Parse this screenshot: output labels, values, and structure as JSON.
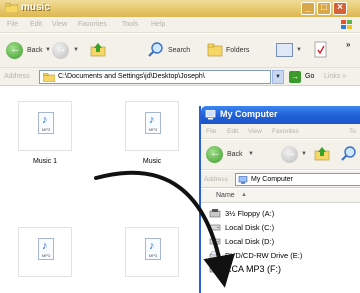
{
  "music_window": {
    "title": "music",
    "menu": [
      "File",
      "Edit",
      "View",
      "Favorites",
      "Tools",
      "Help"
    ],
    "toolbar": {
      "back_label": "Back",
      "search_label": "Search",
      "folders_label": "Folders",
      "overflow": "»"
    },
    "address": {
      "label": "Address",
      "value": "C:\\Documents and Settings\\jd\\Desktop\\Joseph\\",
      "go_label": "Go",
      "links_label": "Links »"
    },
    "files": [
      {
        "label": "Music 1",
        "icon_text": "MP3"
      },
      {
        "label": "Music",
        "icon_text": "MP3"
      },
      {
        "label": "",
        "icon_text": "MP3"
      },
      {
        "label": "",
        "icon_text": "MP3"
      }
    ]
  },
  "my_computer_window": {
    "title": "My Computer",
    "menu": [
      "File",
      "Edit",
      "View",
      "Favorites",
      "To"
    ],
    "toolbar": {
      "back_label": "Back"
    },
    "address": {
      "label": "Address",
      "value": "My Computer"
    },
    "column_header": "Name",
    "drives": [
      {
        "label": "3½ Floppy (A:)",
        "icon": "floppy-icon"
      },
      {
        "label": "Local Disk (C:)",
        "icon": "hard-disk-icon"
      },
      {
        "label": "Local Disk (D:)",
        "icon": "hard-disk-icon"
      },
      {
        "label": "DVD/CD-RW Drive (E:)",
        "icon": "cd-drive-icon"
      },
      {
        "label": "RCA MP3 (F:)",
        "icon": "removable-drive-icon"
      }
    ]
  },
  "colors": {
    "music_titlebar": "#e6c66a",
    "mycomputer_titlebar": "#1f5fd6",
    "toolbar_bg": "#f3f1e9",
    "drag_arrow": "#111111"
  }
}
